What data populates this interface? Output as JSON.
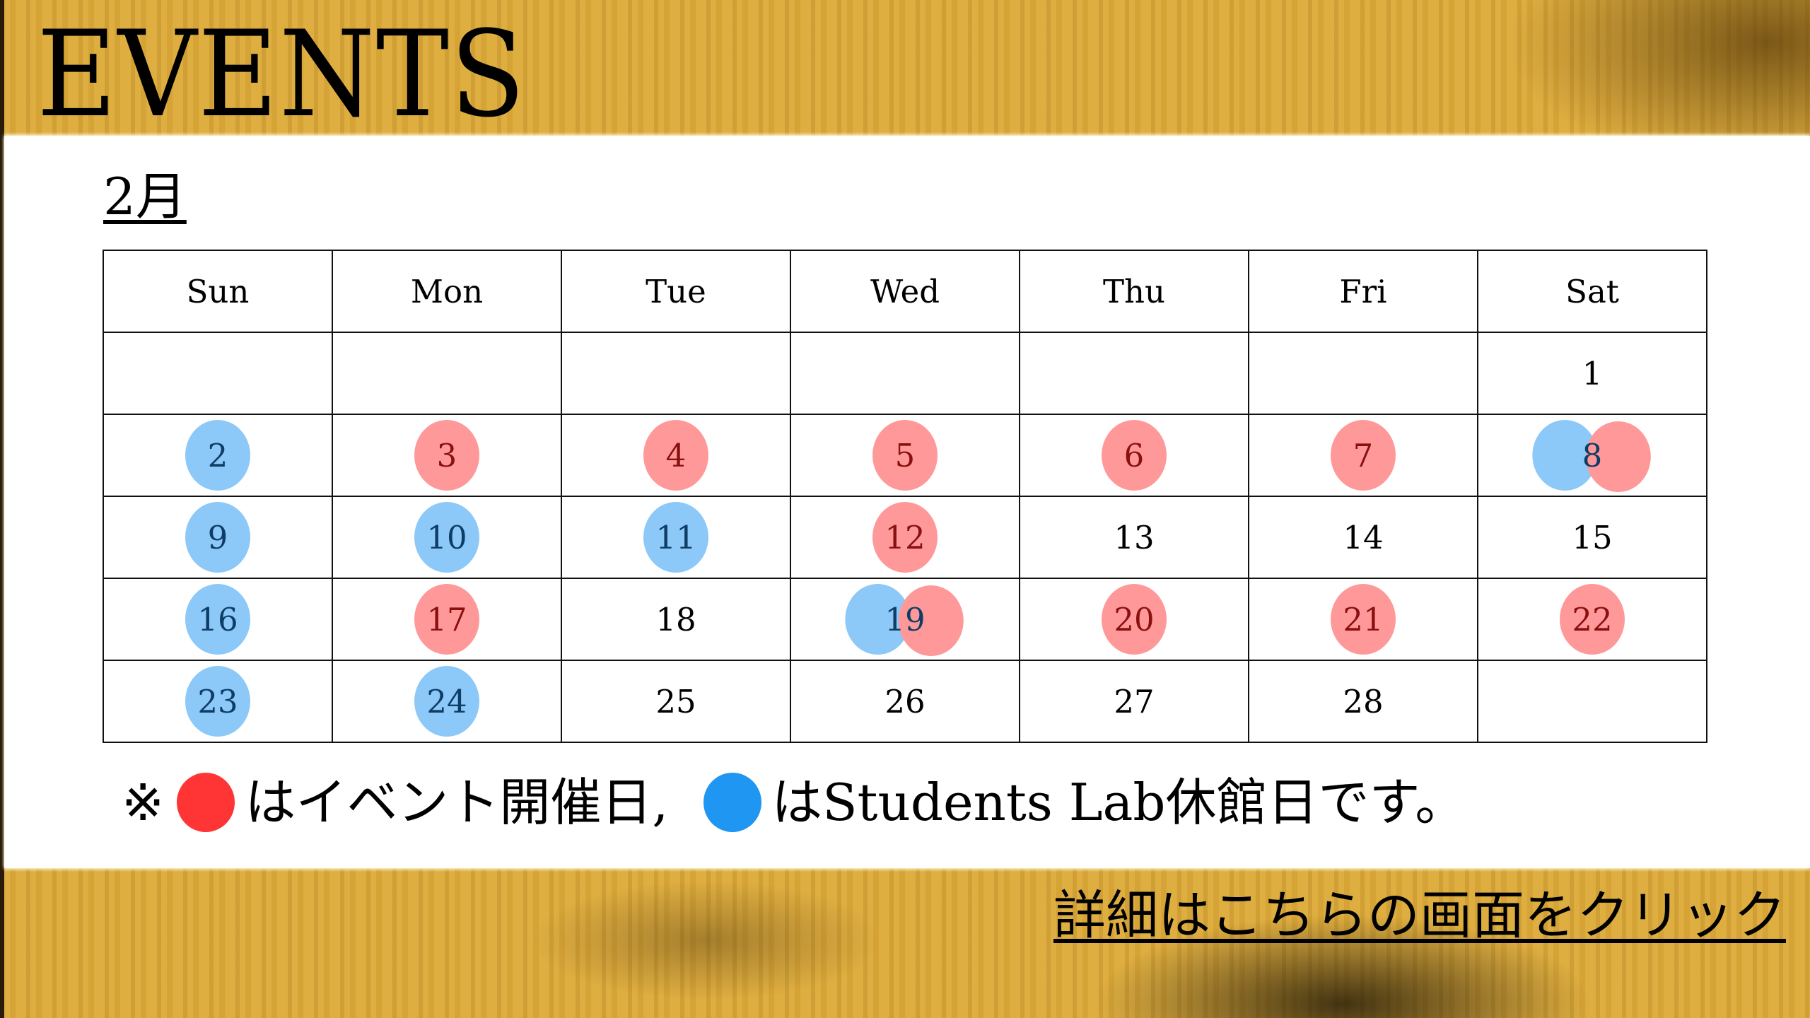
{
  "header": {
    "title": "EVENTS"
  },
  "calendar": {
    "month_label": "2月",
    "weekdays": [
      "Sun",
      "Mon",
      "Tue",
      "Wed",
      "Thu",
      "Fri",
      "Sat"
    ],
    "colors": {
      "event": "#ff9999",
      "closed": "#8cc8f8"
    },
    "weeks": [
      [
        {
          "day": ""
        },
        {
          "day": ""
        },
        {
          "day": ""
        },
        {
          "day": ""
        },
        {
          "day": ""
        },
        {
          "day": ""
        },
        {
          "day": "1"
        }
      ],
      [
        {
          "day": "2",
          "closed": true
        },
        {
          "day": "3",
          "event": true
        },
        {
          "day": "4",
          "event": true
        },
        {
          "day": "5",
          "event": true
        },
        {
          "day": "6",
          "event": true
        },
        {
          "day": "7",
          "event": true
        },
        {
          "day": "8",
          "event": true,
          "closed": true
        }
      ],
      [
        {
          "day": "9",
          "closed": true
        },
        {
          "day": "10",
          "closed": true
        },
        {
          "day": "11",
          "closed": true
        },
        {
          "day": "12",
          "event": true
        },
        {
          "day": "13"
        },
        {
          "day": "14"
        },
        {
          "day": "15"
        }
      ],
      [
        {
          "day": "16",
          "closed": true
        },
        {
          "day": "17",
          "event": true
        },
        {
          "day": "18"
        },
        {
          "day": "19",
          "event": true,
          "closed": true
        },
        {
          "day": "20",
          "event": true
        },
        {
          "day": "21",
          "event": true
        },
        {
          "day": "22",
          "event": true
        }
      ],
      [
        {
          "day": "23",
          "closed": true
        },
        {
          "day": "24",
          "closed": true
        },
        {
          "day": "25"
        },
        {
          "day": "26"
        },
        {
          "day": "27"
        },
        {
          "day": "28"
        },
        {
          "day": ""
        }
      ]
    ]
  },
  "legend": {
    "prefix": "※",
    "event_text": "はイベント開催日,",
    "closed_text": "はStudents Lab休館日です。",
    "event_color": "#ff3535",
    "closed_color": "#1e96f2"
  },
  "footer": {
    "link_label": "詳細はこちらの画面をクリック"
  }
}
